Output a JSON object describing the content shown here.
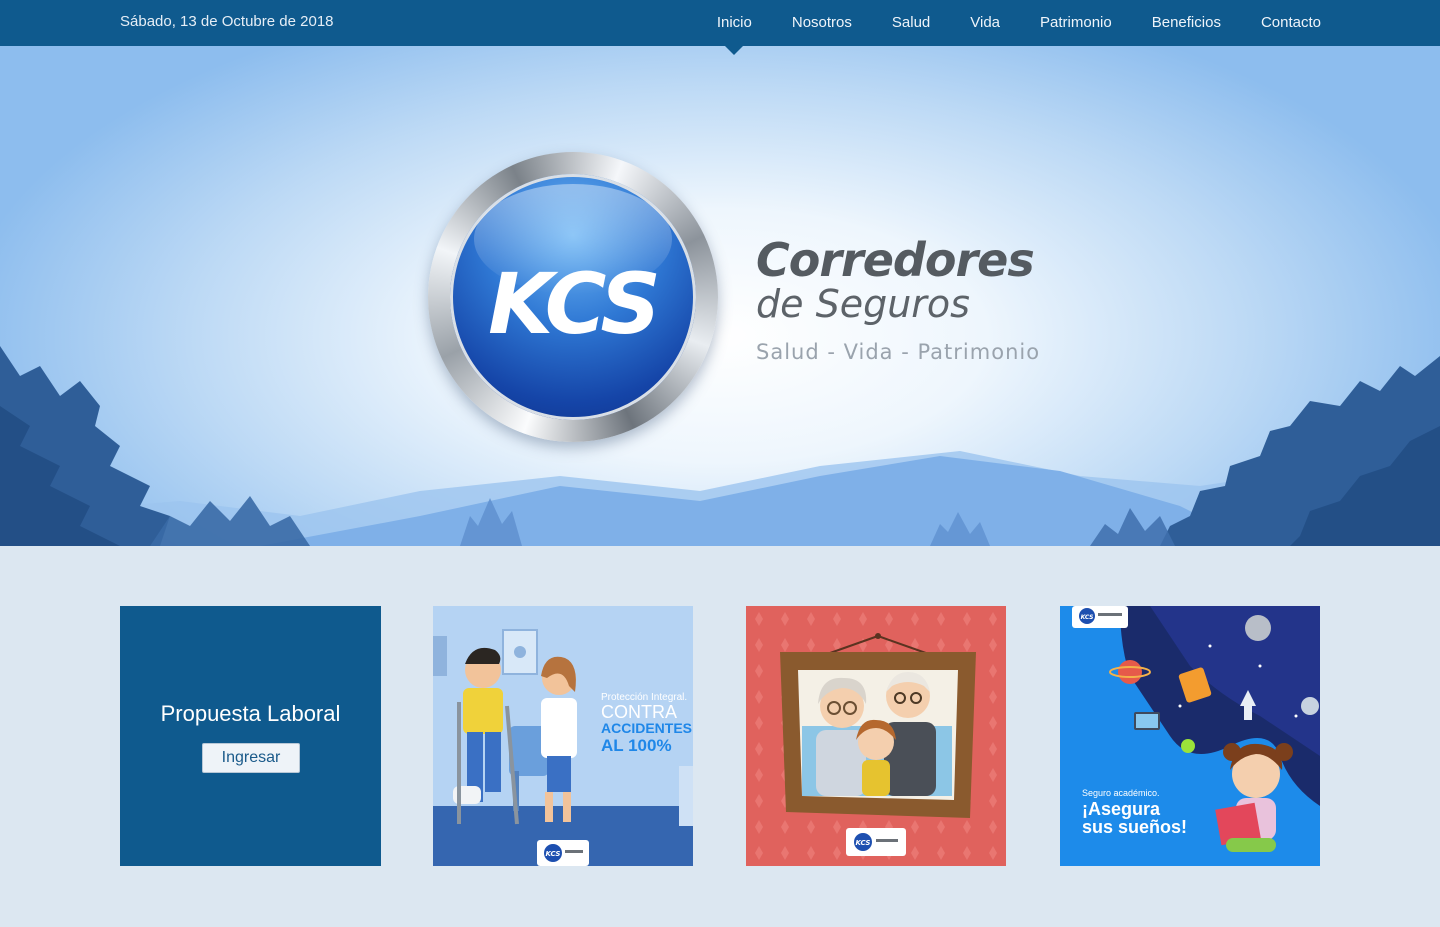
{
  "header": {
    "date": "Sábado, 13 de Octubre de 2018",
    "nav": [
      {
        "label": "Inicio",
        "active": true
      },
      {
        "label": "Nosotros"
      },
      {
        "label": "Salud"
      },
      {
        "label": "Vida"
      },
      {
        "label": "Patrimonio"
      },
      {
        "label": "Beneficios"
      },
      {
        "label": "Contacto"
      }
    ]
  },
  "hero": {
    "logo_text": "KCS",
    "brand_line1": "Corredores",
    "brand_line2": "de Seguros",
    "tagline": "Salud - Vida - Patrimonio"
  },
  "cards": {
    "laboral": {
      "title": "Propuesta Laboral",
      "button": "Ingresar"
    },
    "accidentes": {
      "line1": "Protección Integral.",
      "line2": "CONTRA",
      "line3": "ACCIDENTES",
      "line4": "AL 100%",
      "badge": "KCS"
    },
    "familia": {
      "badge": "KCS"
    },
    "academico": {
      "line1": "Seguro académico.",
      "line2": "¡Asegura",
      "line3": "sus sueños!",
      "badge": "KCS"
    }
  },
  "colors": {
    "brand_blue": "#0f5a8e",
    "page_background": "#dce7f1",
    "accent_blue": "#1f87e8"
  }
}
